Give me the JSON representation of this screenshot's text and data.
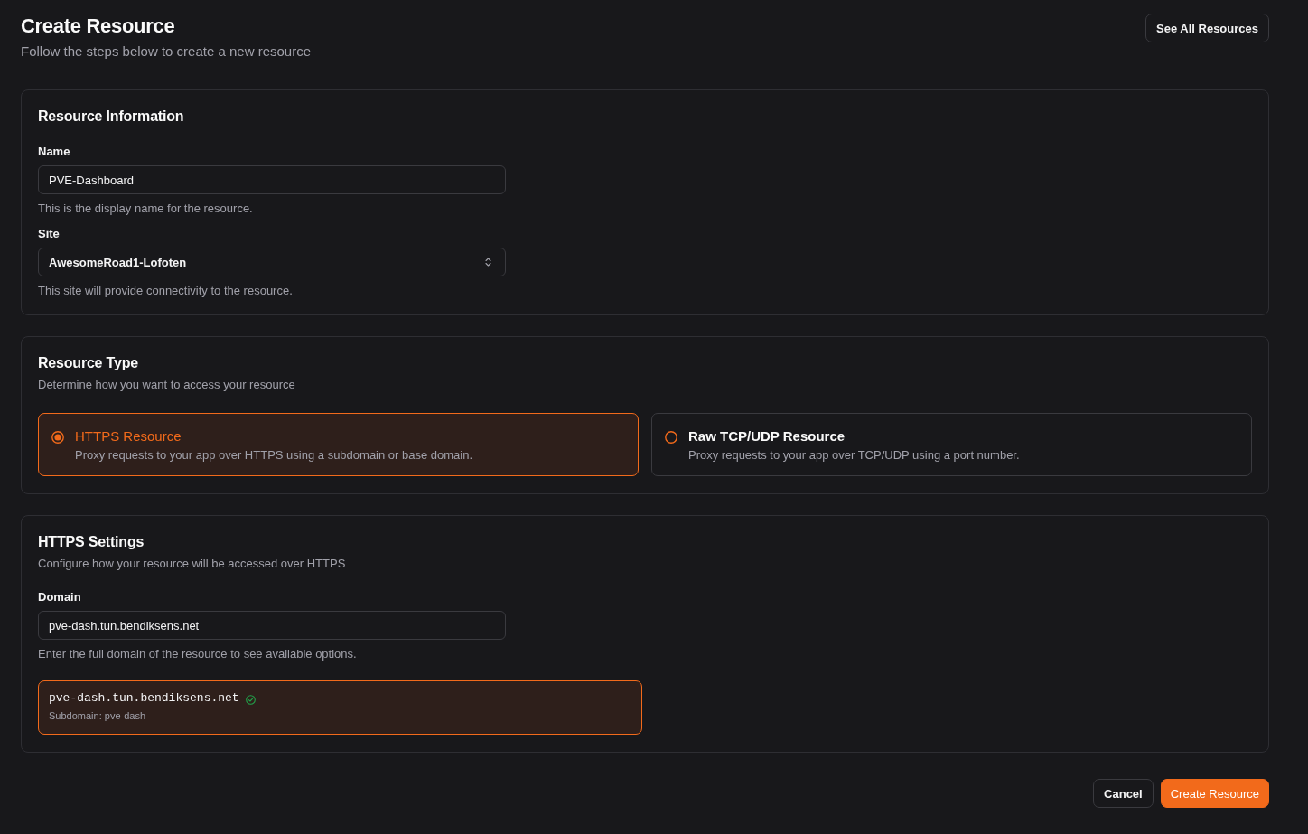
{
  "header": {
    "title": "Create Resource",
    "subtitle": "Follow the steps below to create a new resource",
    "see_all_button": "See All Resources"
  },
  "resource_information": {
    "title": "Resource Information",
    "fields": [
      {
        "kind": "text",
        "label": "Name",
        "value": "PVE-Dashboard",
        "help": "This is the display name for the resource."
      },
      {
        "kind": "select",
        "label": "Site",
        "value": "AwesomeRoad1-Lofoten",
        "help": "This site will provide connectivity to the resource."
      }
    ]
  },
  "resource_type": {
    "title": "Resource Type",
    "description": "Determine how you want to access your resource",
    "options": [
      {
        "title": "HTTPS Resource",
        "description": "Proxy requests to your app over HTTPS using a subdomain or base domain.",
        "selected": true
      },
      {
        "title": "Raw TCP/UDP Resource",
        "description": "Proxy requests to your app over TCP/UDP using a port number.",
        "selected": false
      }
    ]
  },
  "https_settings": {
    "title": "HTTPS Settings",
    "description": "Configure how your resource will be accessed over HTTPS",
    "fields": [
      {
        "kind": "text",
        "label": "Domain",
        "value": "pve-dash.tun.bendiksens.net",
        "help": "Enter the full domain of the resource to see available options."
      }
    ],
    "domain_result": {
      "domain": "pve-dash.tun.bendiksens.net",
      "verified": true,
      "subdomain": "Subdomain: pve-dash"
    }
  },
  "actions": [
    {
      "kind": "secondary",
      "label": "Cancel"
    },
    {
      "kind": "primary",
      "label": "Create Resource"
    }
  ]
}
